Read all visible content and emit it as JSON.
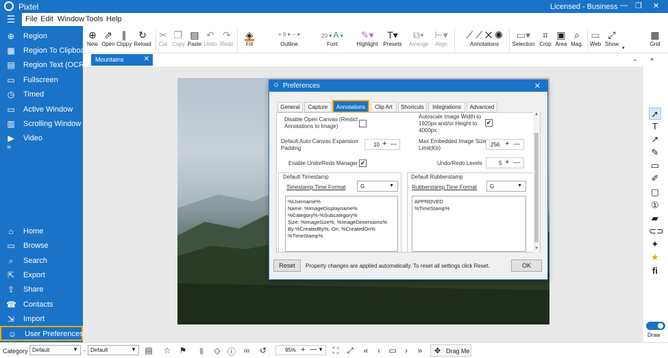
{
  "app": {
    "title": "Pixtel",
    "license": "Licensed - Business",
    "win_min": "—",
    "win_max": "❐",
    "win_close": "✕"
  },
  "menu": [
    "File",
    "Edit",
    "Window",
    "Tools",
    "Help"
  ],
  "sidebar": {
    "items": [
      {
        "label": "Region",
        "icon": "⊕"
      },
      {
        "label": "Region To Clipboard",
        "icon": "▦"
      },
      {
        "label": "Region Text (OCR)",
        "icon": "▤"
      },
      {
        "label": "Fullscreen",
        "icon": "▭"
      },
      {
        "label": "Timed",
        "icon": "◷"
      },
      {
        "label": "Active Window",
        "icon": "▭"
      },
      {
        "label": "Scrolling Window",
        "icon": "▥"
      },
      {
        "label": "Video",
        "icon": "▶"
      }
    ],
    "more": "»",
    "bottom_items": [
      {
        "label": "Home",
        "icon": "⌂"
      },
      {
        "label": "Browse",
        "icon": "▭"
      },
      {
        "label": "Search",
        "icon": "⌕"
      },
      {
        "label": "Export",
        "icon": "⇱"
      },
      {
        "label": "Share",
        "icon": "⇪"
      },
      {
        "label": "Contacts",
        "icon": "☎"
      },
      {
        "label": "Import",
        "icon": "⇲"
      },
      {
        "label": "User Preferences",
        "icon": "☺"
      }
    ]
  },
  "toolbar": {
    "new": "New",
    "open": "Open",
    "clippy": "Clippy",
    "reload": "Reload",
    "cut": "Cut",
    "copy": "Copy",
    "paste": "Paste",
    "undo": "Undo",
    "redo": "Redo",
    "fill": "Fill",
    "outline": "Outline",
    "line_width": "8",
    "font_size": "20",
    "font": "Font",
    "highlight": "Highlight",
    "presets": "Presets",
    "arrange": "Arrange",
    "align": "Align",
    "annotations": "Annotations",
    "selection": "Selection",
    "crop": "Crop",
    "area": "Area",
    "mag": "Mag.",
    "web": "Web",
    "show": "Show",
    "grid": "Grid"
  },
  "tabs": {
    "doc": "Mountains",
    "close": "✕"
  },
  "dialog": {
    "title": "Preferences",
    "close": "✕",
    "tabs": [
      "General",
      "Capture",
      "Annotations",
      "Clip Art",
      "Shortcuts",
      "Integrations",
      "Advanced"
    ],
    "active_tab": "Annotations",
    "disable_open_canvas": "Disable Open Canvas (Restict Annotations to Image)",
    "autoscale": "Autoscale Image Width to 1920px and/or Height to 4000px",
    "autoscale_checked": "✔",
    "auto_canvas_label": "Default Auto Canvas Expansion Padding",
    "auto_canvas_value": "10",
    "max_embedded_label": "Max Embedded Image Size Limit(Kb)",
    "max_embedded_value": "256",
    "undo_redo_label": "Enable Undo/Redo Manager",
    "undo_redo_checked": "✔",
    "undo_levels_label": "Undo/Redo Levels",
    "undo_levels_value": "5",
    "plus": "+",
    "minus": "—",
    "timestamp_group": "Default Timestamp",
    "timestamp_format_label": "Timestamp Time Format",
    "timestamp_format_value": "G",
    "timestamp_text": "%Username%\nName: %ImageDisplayname%\n%Category%-%Subcategory%\nSize: %ImageSize%, %ImageDimensions%\nBy:%CreatedBy%, On: %CreatedOn%\n%TimeStamp%",
    "rubberstamp_group": "Default Rubberstamp",
    "rubberstamp_format_label": "Rubberstamp Time Format",
    "rubberstamp_format_value": "G",
    "rubberstamp_text": "APPROVED\n%TimeStamp%",
    "reset": "Reset",
    "footer_note": "Property changes are applied automatically. To reset all settings click Reset.",
    "ok": "OK"
  },
  "statusbar": {
    "category_label": "Category",
    "category_value": "Default",
    "dash": "-",
    "subcategory_value": "Default",
    "zoom": "95%",
    "drag_me": "Drag Me"
  },
  "right": {
    "draw": "Draw"
  }
}
